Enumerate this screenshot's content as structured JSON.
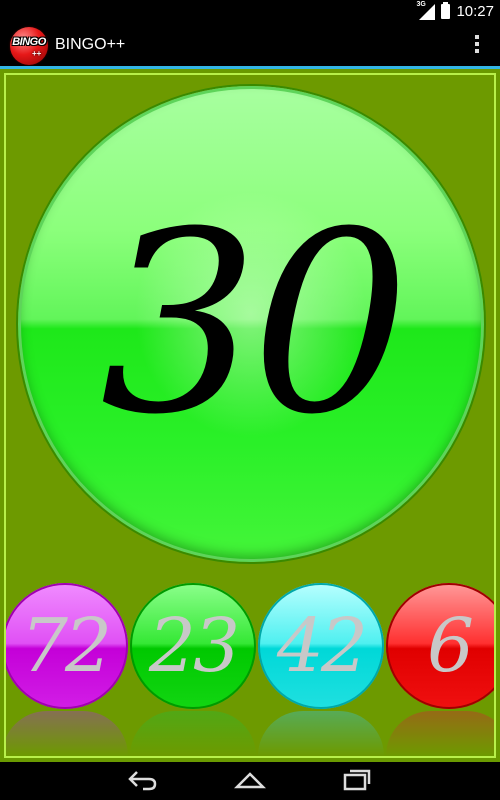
{
  "status_bar": {
    "network": "3G",
    "time": "10:27",
    "icons": [
      "signal-icon",
      "battery-icon"
    ]
  },
  "action_bar": {
    "app_icon_text": "BINGO",
    "app_icon_subtext": "++",
    "title": "BINGO++",
    "menu_icon": "overflow-menu-icon"
  },
  "game": {
    "current_number": "30",
    "previous_numbers": [
      "72",
      "23",
      "42",
      "6"
    ],
    "colors": {
      "board": "#6d9a00",
      "board_border": "#b8f04a",
      "current_ball": "#2af028",
      "ball_colors": [
        "#c400d8",
        "#00c800",
        "#00d8d8",
        "#e00000"
      ],
      "number_text_previous": "#c8c8c8",
      "accent": "#33b5e5"
    }
  },
  "nav_bar": {
    "icons": [
      "back-icon",
      "home-icon",
      "recent-apps-icon"
    ]
  }
}
